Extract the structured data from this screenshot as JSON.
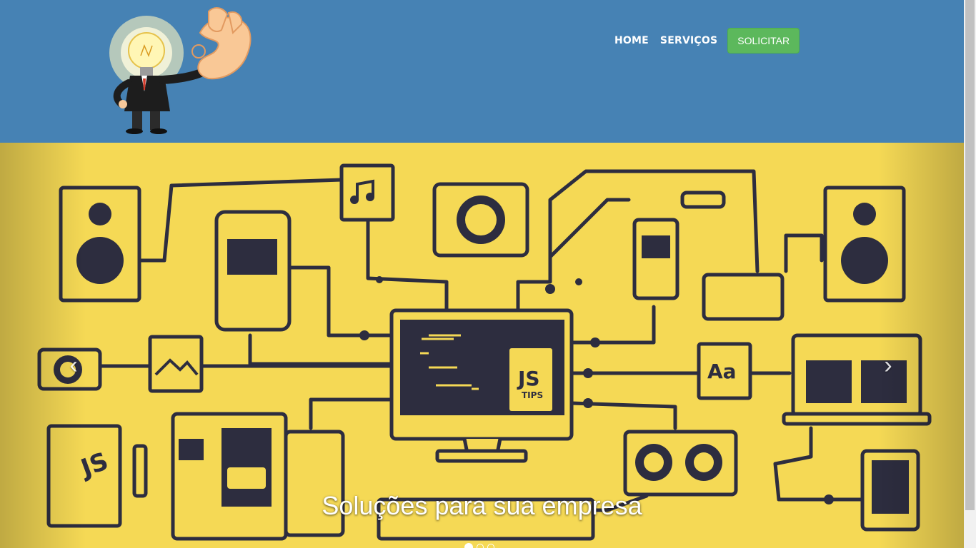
{
  "header": {
    "logo_icon": "lightbulb-businessman-ok-hand-logo",
    "nav": [
      {
        "label": "HOME"
      },
      {
        "label": "SERVIÇOS"
      }
    ],
    "cta_label": "SOLICITAR",
    "colors": {
      "background": "#4682b4",
      "cta": "#5cb85c"
    }
  },
  "carousel": {
    "caption": "Soluções para sua empresa",
    "prev_icon": "chevron-left-icon",
    "next_icon": "chevron-right-icon",
    "slide_count": 3,
    "active_slide": 1,
    "image_icon": "connected-devices-illustration",
    "colors": {
      "background": "#f5d955",
      "lines": "#2d2d3f"
    }
  },
  "slide_text": {
    "js_book": "JS",
    "js_tips_big": "JS",
    "js_tips_small": "TIPS",
    "font_card": "Aa"
  }
}
